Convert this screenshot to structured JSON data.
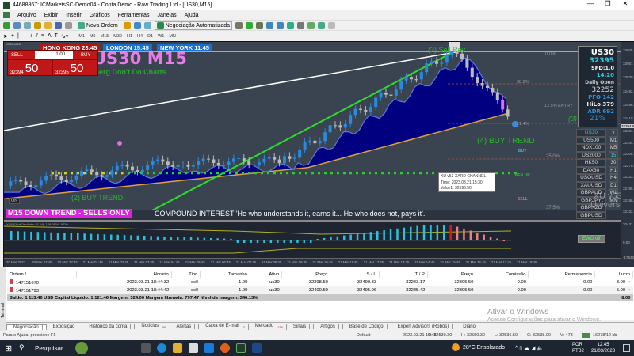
{
  "window": {
    "title": "44688867: ICMarketsSC-Demo04 - Conta Demo - Raw Trading Ltd - [US30,M15]",
    "controls": [
      "—",
      "❐",
      "✕"
    ]
  },
  "menu": [
    "Arquivo",
    "Exibir",
    "Inserir",
    "Gráficos",
    "Ferramentas",
    "Janelas",
    "Ajuda"
  ],
  "toolbar": {
    "new_order": "Nova Ordem",
    "auto_trading": "Negociação Automatizada",
    "timeframes": [
      "M1",
      "M5",
      "M15",
      "M30",
      "H1",
      "H4",
      "D1",
      "W1",
      "MN"
    ]
  },
  "chart": {
    "tab": "US30,M15",
    "clocks": [
      {
        "label": "HONG KONG 23:45",
        "color": "#b01818"
      },
      {
        "label": "LONDON  15:45",
        "color": "#1a6fd0"
      },
      {
        "label": "NEW YORK  11:45",
        "color": "#1a6fd0"
      }
    ],
    "trade_panel": {
      "sell": "SELL",
      "buy": "BUY",
      "lot": "1.00",
      "sell_price_small": "32394",
      "sell_price_big": "50",
      "buy_price_small": "32395",
      "buy_price_big": "50"
    },
    "title": "US30 M15",
    "subtitle": "Gansberg Don't Do Charts",
    "labels": {
      "sell_rev": "(3) Sell Rev",
      "buy_trend2": "(2) BUY TREND",
      "buy_trend4": "(4) BUY TREND",
      "three": "(3)",
      "buy": "BUY",
      "pen_up": "PEN UP",
      "sell": "SELL",
      "on": "ON"
    },
    "fib": [
      "0.0%",
      "38.2%",
      "12.5% ENTRY",
      "21.4%",
      "25.0%",
      "37.5%"
    ],
    "tooltip": [
      "XU v53-XARD CHANNEL",
      "Time: 2023.03.21 15:30",
      "Value1: 32596.50"
    ],
    "info": {
      "symbol": "US30",
      "price": "32395",
      "spread": "SPD:1.0",
      "timer": "14:20",
      "daily_open_label": "Daily Open",
      "daily_open": "32252",
      "pfo": "PFO 142",
      "hilo": "HiLo 379",
      "adr": "ADR 692",
      "pct": "21%"
    },
    "symbols": [
      "US30",
      "US500",
      "NDX100",
      "US2000",
      "HK50",
      "DAX30",
      "USOUSD",
      "XAUUSD",
      "GBPAUD",
      "GBPJPY",
      "GBPNZD",
      "GBPUSD"
    ],
    "tf_buttons": [
      "v",
      "M1",
      "M5",
      "15",
      "30",
      "H1",
      "H4",
      "D1",
      "W1",
      "MN"
    ],
    "watermark": [
      "XU v53",
      "Universe"
    ],
    "price_axis": [
      "32605.0",
      "32567.6",
      "32530.2",
      "32492.8",
      "32456.2",
      "32419.1",
      "32394.5",
      "32381.7",
      "32344.3",
      "32306.9",
      "32270.4",
      "32233.2",
      "32195.8",
      "32158.4",
      "32122.1"
    ],
    "down_trend": "M15  DOWN TREND - SELLS ONLY",
    "compound": "COMPOUND INTEREST  'He who understands it, earns it... He who does not, pays it'.",
    "osc_label": "XU5-Elliot Oscillator (5,34) -129.9504 -8720",
    "osc_axis": [
      "20431",
      "0.00",
      "-17532"
    ],
    "ewo_button": "EWO off",
    "time_axis": [
      "20 Mar 2023",
      "20 Mar 22:45",
      "20 Mar 23:45",
      "21 Mar 01:45",
      "21 Mar 02:45",
      "21 Mar 03:45",
      "21 Mar 04:45",
      "21 Mar 05:45",
      "21 Mar 06:45",
      "21 Mar 07:45",
      "21 Mar 08:45",
      "21 Mar 09:45",
      "21 Mar 10:45",
      "21 Mar 11:45",
      "21 Mar 12:45",
      "21 Mar 13:45",
      "21 Mar 14:45",
      "21 Mar 15:45",
      "21 Mar 16:45",
      "21 Mar 17:45",
      "21 Mar 18:45"
    ]
  },
  "terminal": {
    "headers": [
      "Ordem  /",
      "Horário",
      "Tipo",
      "Tamanho",
      "Ativo",
      "Preço",
      "S / L",
      "T / P",
      "Preço",
      "Comissão",
      "Permanencia",
      "Lucro"
    ],
    "rows": [
      [
        "147151670",
        "2023.03.21 18:44:32",
        "sell",
        "1.00",
        "us30",
        "32398.50",
        "32490.33",
        "32283.17",
        "32395.50",
        "0.00",
        "0.00",
        "3.00"
      ],
      [
        "147151793",
        "2023.03.21 18:44:42",
        "sell",
        "1.00",
        "us30",
        "32400.50",
        "32495.96",
        "32285.42",
        "32395.50",
        "0.00",
        "0.00",
        "5.00"
      ]
    ],
    "balance": "Saldo: 1 113.46 USD  Capital Líquido: 1 121.46  Margem: 324.00  Margem liberada: 797.47  Nível da margem: 346.13%",
    "total": "8.00",
    "side_label": "Terminal",
    "tabs": [
      {
        "label": "Negociação"
      },
      {
        "label": "Exposição"
      },
      {
        "label": "Histórico da conta"
      },
      {
        "label": "Notícias",
        "badge": "99"
      },
      {
        "label": "Alertas"
      },
      {
        "label": "Caixa de E-mail",
        "badge": "7"
      },
      {
        "label": "Mercado",
        "badge": "136"
      },
      {
        "label": "Sinais"
      },
      {
        "label": "Artigos"
      },
      {
        "label": "Base de Código"
      },
      {
        "label": "Expert Advisors (Robôs)"
      },
      {
        "label": "Diário"
      }
    ]
  },
  "activation": {
    "title": "Ativar o Windows",
    "subtitle": "Acesse Configurações para ativar o Windows."
  },
  "status": {
    "help": "Para o Ajuda, pressione F1",
    "profile": "Default",
    "time": "2023.03.21 15:45",
    "open": "O: 32530.30",
    "high": "H: 32550.30",
    "low": "L: 32536.50",
    "close": "C: 32538.00",
    "volume": "V: 473",
    "traffic": "16278/12 kb"
  },
  "taskbar": {
    "search": "Pesquisar",
    "weather": "28°C  Ensolarado",
    "lang1": "POR",
    "lang2": "PTB2",
    "time": "12:45",
    "date": "21/03/2023"
  }
}
